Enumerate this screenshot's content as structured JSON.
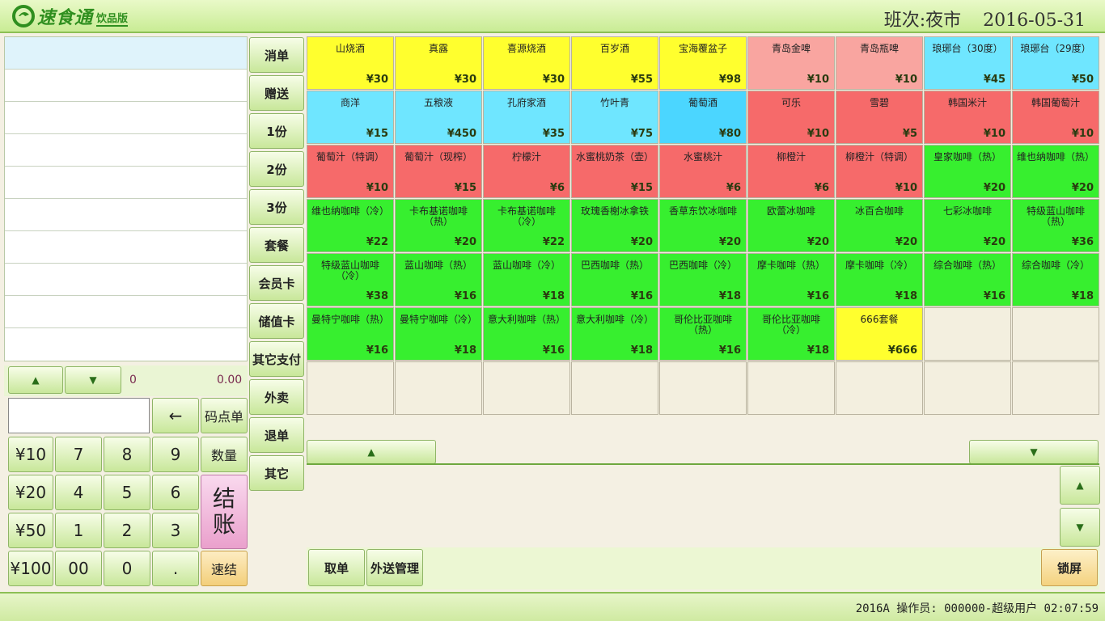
{
  "header": {
    "logo_text": "速食通",
    "logo_sub": "饮品版",
    "shift_label": "班次:夜市",
    "date": "2016-05-31"
  },
  "footer": {
    "status": "2016A 操作员: 000000-超级用户  02:07:59"
  },
  "order_summary": {
    "qty": "0",
    "amount": "0.00"
  },
  "keypad": {
    "backspace": "←",
    "code_order": "码点单",
    "quantity": "数量",
    "checkout_line1": "结",
    "checkout_line2": "账",
    "quick_checkout": "速结",
    "keys": [
      "¥10",
      "7",
      "8",
      "9",
      "¥20",
      "4",
      "5",
      "6",
      "¥50",
      "1",
      "2",
      "3",
      "¥100",
      "00",
      "0",
      "."
    ]
  },
  "functions": [
    "消单",
    "赠送",
    "1份",
    "2份",
    "3份",
    "套餐",
    "会员卡",
    "储值卡",
    "其它支付",
    "外卖",
    "退单",
    "其它"
  ],
  "actions": {
    "take_order": "取单",
    "delivery_mgmt": "外送管理",
    "lock_screen": "锁屏"
  },
  "colors": {
    "yellow": "#ffff2e",
    "pink": "#f9a5a0",
    "cyan": "#6fe6ff",
    "blue": "#4bd6ff",
    "red": "#f66a6a",
    "green": "#37ef2f"
  },
  "products": [
    {
      "name": "山烧酒",
      "price": "¥30",
      "color": "yellow"
    },
    {
      "name": "真露",
      "price": "¥30",
      "color": "yellow"
    },
    {
      "name": "喜源烧酒",
      "price": "¥30",
      "color": "yellow"
    },
    {
      "name": "百岁酒",
      "price": "¥55",
      "color": "yellow"
    },
    {
      "name": "宝海覆盆子",
      "price": "¥98",
      "color": "yellow"
    },
    {
      "name": "青岛金啤",
      "price": "¥10",
      "color": "pink"
    },
    {
      "name": "青岛瓶啤",
      "price": "¥10",
      "color": "pink"
    },
    {
      "name": "琅琊台（30度）",
      "price": "¥45",
      "color": "cyan"
    },
    {
      "name": "琅琊台（29度）",
      "price": "¥50",
      "color": "cyan"
    },
    {
      "name": "商洋",
      "price": "¥15",
      "color": "cyan"
    },
    {
      "name": "五粮液",
      "price": "¥450",
      "color": "cyan"
    },
    {
      "name": "孔府家酒",
      "price": "¥35",
      "color": "cyan"
    },
    {
      "name": "竹叶青",
      "price": "¥75",
      "color": "cyan"
    },
    {
      "name": "葡萄酒",
      "price": "¥80",
      "color": "blue"
    },
    {
      "name": "可乐",
      "price": "¥10",
      "color": "red"
    },
    {
      "name": "雪碧",
      "price": "¥5",
      "color": "red"
    },
    {
      "name": "韩国米汁",
      "price": "¥10",
      "color": "red"
    },
    {
      "name": "韩国葡萄汁",
      "price": "¥10",
      "color": "red"
    },
    {
      "name": "葡萄汁（特调）",
      "price": "¥10",
      "color": "red"
    },
    {
      "name": "葡萄汁（现榨）",
      "price": "¥15",
      "color": "red"
    },
    {
      "name": "柠檬汁",
      "price": "¥6",
      "color": "red"
    },
    {
      "name": "水蜜桃奶茶（壶）",
      "price": "¥15",
      "color": "red"
    },
    {
      "name": "水蜜桃汁",
      "price": "¥6",
      "color": "red"
    },
    {
      "name": "柳橙汁",
      "price": "¥6",
      "color": "red"
    },
    {
      "name": "柳橙汁（特调）",
      "price": "¥10",
      "color": "red"
    },
    {
      "name": "皇家咖啡（热）",
      "price": "¥20",
      "color": "green"
    },
    {
      "name": "维也纳咖啡（热）",
      "price": "¥20",
      "color": "green"
    },
    {
      "name": "维也纳咖啡（冷）",
      "price": "¥22",
      "color": "green"
    },
    {
      "name": "卡布基诺咖啡（热）",
      "price": "¥20",
      "color": "green"
    },
    {
      "name": "卡布基诺咖啡（冷）",
      "price": "¥22",
      "color": "green"
    },
    {
      "name": "玫瑰香榭冰拿铁",
      "price": "¥20",
      "color": "green"
    },
    {
      "name": "香草东饮冰咖啡",
      "price": "¥20",
      "color": "green"
    },
    {
      "name": "欧蕾冰咖啡",
      "price": "¥20",
      "color": "green"
    },
    {
      "name": "冰百合咖啡",
      "price": "¥20",
      "color": "green"
    },
    {
      "name": "七彩冰咖啡",
      "price": "¥20",
      "color": "green"
    },
    {
      "name": "特级蓝山咖啡（热）",
      "price": "¥36",
      "color": "green"
    },
    {
      "name": "特级蓝山咖啡（冷）",
      "price": "¥38",
      "color": "green"
    },
    {
      "name": "蓝山咖啡（热）",
      "price": "¥16",
      "color": "green"
    },
    {
      "name": "蓝山咖啡（冷）",
      "price": "¥18",
      "color": "green"
    },
    {
      "name": "巴西咖啡（热）",
      "price": "¥16",
      "color": "green"
    },
    {
      "name": "巴西咖啡（冷）",
      "price": "¥18",
      "color": "green"
    },
    {
      "name": "摩卡咖啡（热）",
      "price": "¥16",
      "color": "green"
    },
    {
      "name": "摩卡咖啡（冷）",
      "price": "¥18",
      "color": "green"
    },
    {
      "name": "综合咖啡（热）",
      "price": "¥16",
      "color": "green"
    },
    {
      "name": "综合咖啡（冷）",
      "price": "¥18",
      "color": "green"
    },
    {
      "name": "曼特宁咖啡（热）",
      "price": "¥16",
      "color": "green"
    },
    {
      "name": "曼特宁咖啡（冷）",
      "price": "¥18",
      "color": "green"
    },
    {
      "name": "意大利咖啡（热）",
      "price": "¥16",
      "color": "green"
    },
    {
      "name": "意大利咖啡（冷）",
      "price": "¥18",
      "color": "green"
    },
    {
      "name": "哥伦比亚咖啡（热）",
      "price": "¥16",
      "color": "green"
    },
    {
      "name": "哥伦比亚咖啡（冷）",
      "price": "¥18",
      "color": "green"
    },
    {
      "name": "666套餐",
      "price": "¥666",
      "color": "yellow"
    }
  ]
}
